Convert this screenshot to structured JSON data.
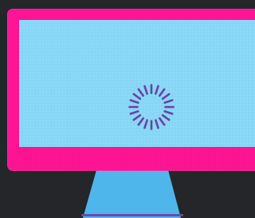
{
  "colors": {
    "background": "#25262a",
    "frame": "#ff1493",
    "screen": "#87d7f6",
    "stand": "#4fb6eb",
    "spinner": "#6a42a5",
    "foot_shadow": "#6a4aa8"
  },
  "icons": {
    "loading": "loading-spinner-icon",
    "monitor": "monitor-icon"
  }
}
